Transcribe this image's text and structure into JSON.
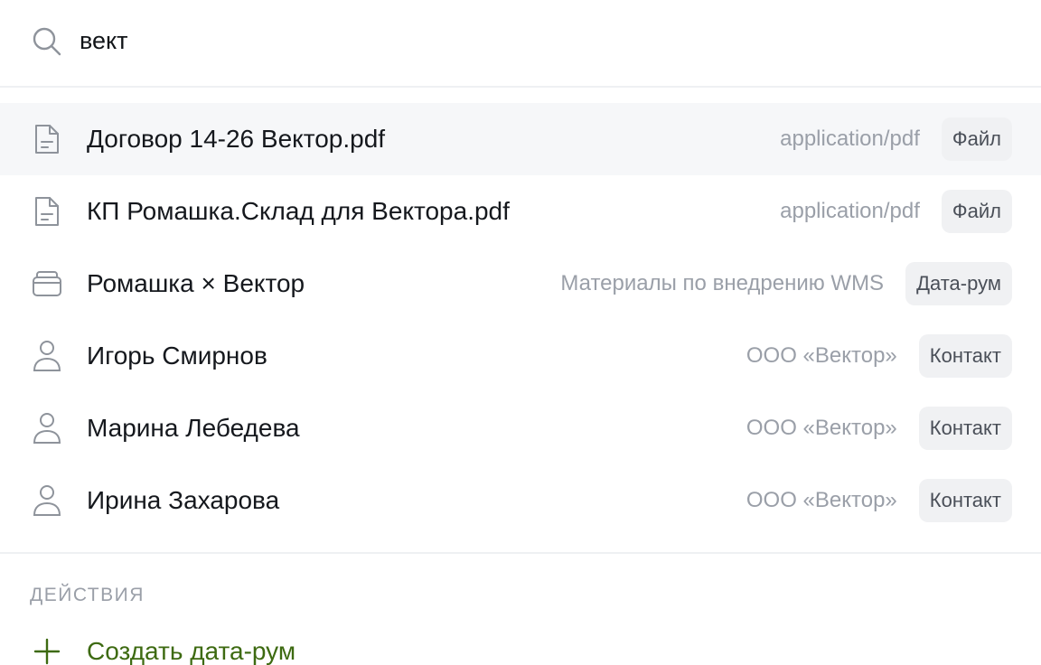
{
  "search": {
    "value": "вект",
    "icon": "search-icon"
  },
  "results": [
    {
      "title": "Договор 14-26 Вектор.pdf",
      "meta": "application/pdf",
      "badge": "Файл",
      "icon": "file-icon"
    },
    {
      "title": "КП Ромашка.Склад для Вектора.pdf",
      "meta": "application/pdf",
      "badge": "Файл",
      "icon": "file-icon"
    },
    {
      "title": "Ромашка × Вектор",
      "meta": "Материалы по внедрению WMS",
      "badge": "Дата-рум",
      "icon": "folder-icon"
    },
    {
      "title": "Игорь Смирнов",
      "meta": "ООО «Вектор»",
      "badge": "Контакт",
      "icon": "user-icon"
    },
    {
      "title": "Марина Лебедева",
      "meta": "ООО «Вектор»",
      "badge": "Контакт",
      "icon": "user-icon"
    },
    {
      "title": "Ирина Захарова",
      "meta": "ООО «Вектор»",
      "badge": "Контакт",
      "icon": "user-icon"
    }
  ],
  "actions": {
    "section_label": "ДЕЙСТВИЯ",
    "items": [
      {
        "label": "Создать дата-рум",
        "icon": "plus-icon"
      }
    ]
  },
  "colors": {
    "accent_green": "#3d6a11",
    "active_row_bg": "#f6f7f9",
    "badge_bg": "#f0f1f3",
    "muted_text": "#9a9fa8"
  }
}
